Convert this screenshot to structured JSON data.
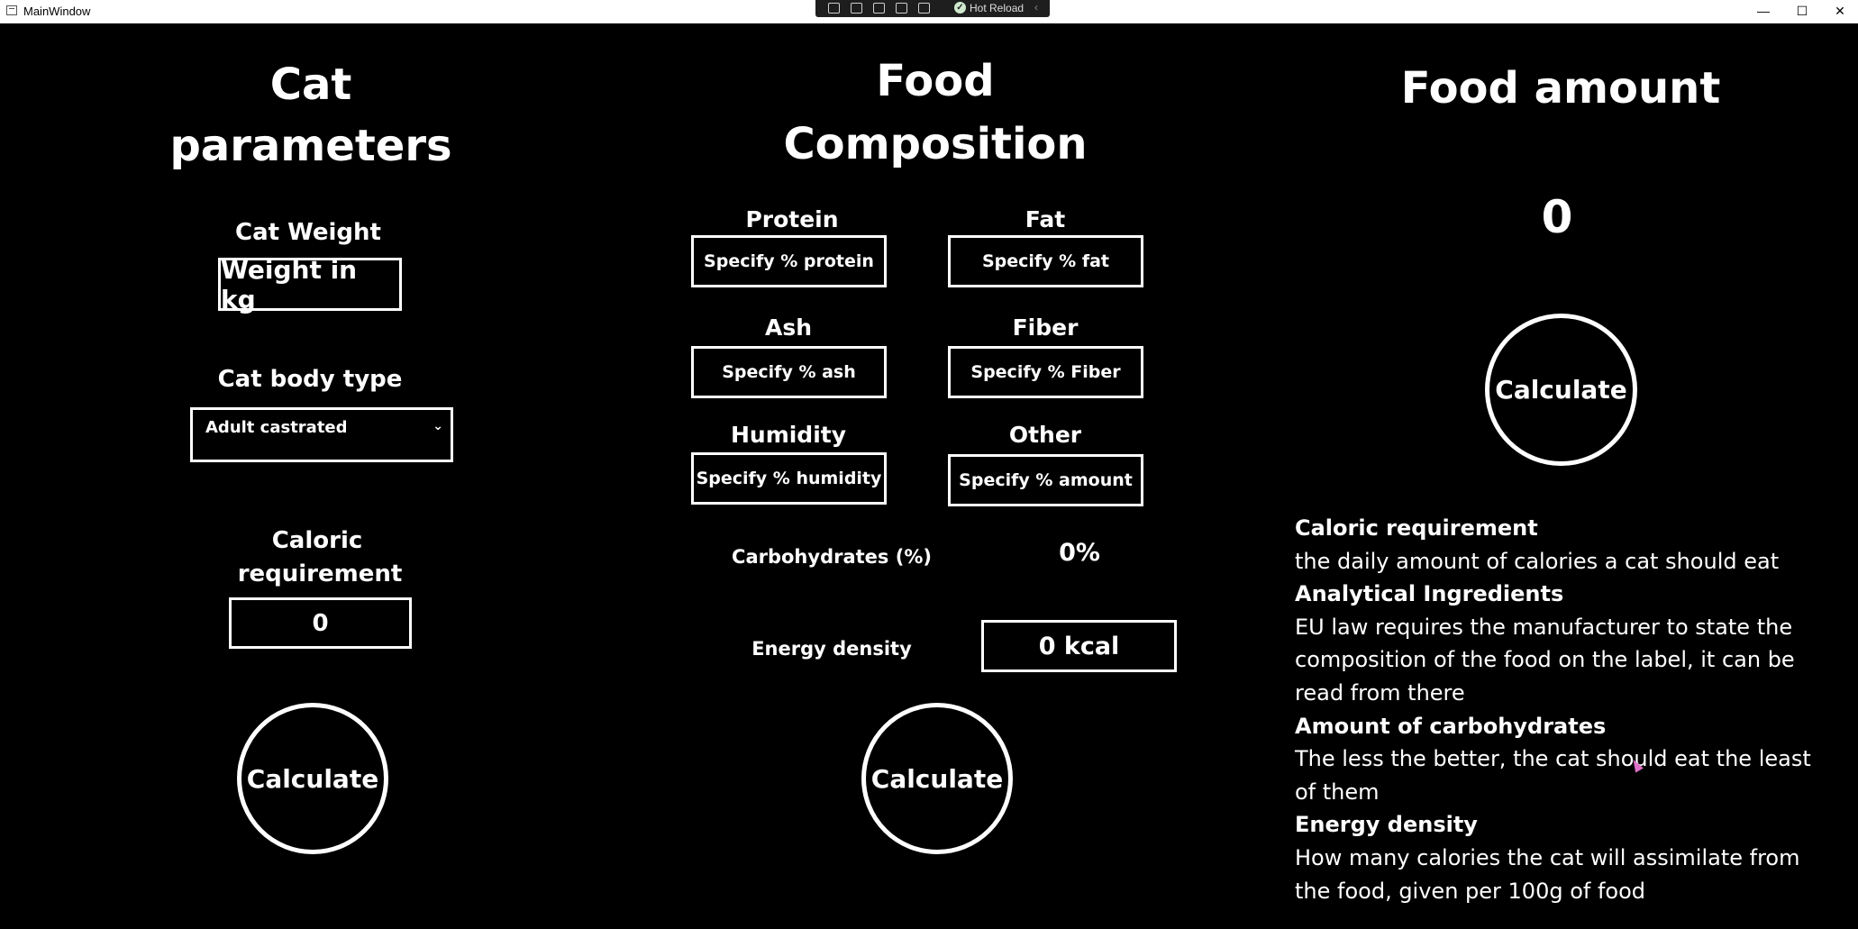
{
  "window": {
    "title": "MainWindow",
    "toolbar": {
      "hot_reload_label": "Hot Reload"
    },
    "controls": {
      "minimize": "—",
      "maximize": "☐",
      "close": "✕"
    }
  },
  "cat_params": {
    "heading_line1": "Cat",
    "heading_line2": "parameters",
    "weight_label": "Cat Weight",
    "weight_placeholder": "Weight in kg",
    "body_type_label": "Cat body type",
    "body_type_value": "Adult castrated",
    "caloric_label_line1": "Caloric",
    "caloric_label_line2": "requirement",
    "caloric_value": "0",
    "calculate_label": "Calculate"
  },
  "food_comp": {
    "heading_line1": "Food",
    "heading_line2": "Composition",
    "protein_label": "Protein",
    "protein_placeholder": "Specify % protein",
    "fat_label": "Fat",
    "fat_placeholder": "Specify % fat",
    "ash_label": "Ash",
    "ash_placeholder": "Specify % ash",
    "fiber_label": "Fiber",
    "fiber_placeholder": "Specify % Fiber",
    "humidity_label": "Humidity",
    "humidity_placeholder": "Specify % humidity",
    "other_label": "Other",
    "other_placeholder": "Specify % amount",
    "carbs_label": "Carbohydrates (%)",
    "carbs_value": "0%",
    "energy_label": "Energy density",
    "energy_value": "0 kcal",
    "calculate_label": "Calculate"
  },
  "food_amount": {
    "heading": "Food amount",
    "value": "0",
    "calculate_label": "Calculate"
  },
  "info": [
    {
      "title": "Caloric requirement",
      "text": "the daily amount of calories a cat should eat"
    },
    {
      "title": "Analytical Ingredients",
      "text": "EU law requires the manufacturer to state the composition of the food on the label, it can be read from there"
    },
    {
      "title": "Amount of carbohydrates",
      "text": "The less the better, the cat should eat the least of them"
    },
    {
      "title": "Energy density",
      "text": "How many calories the cat will assimilate from the food, given per 100g of food"
    }
  ]
}
